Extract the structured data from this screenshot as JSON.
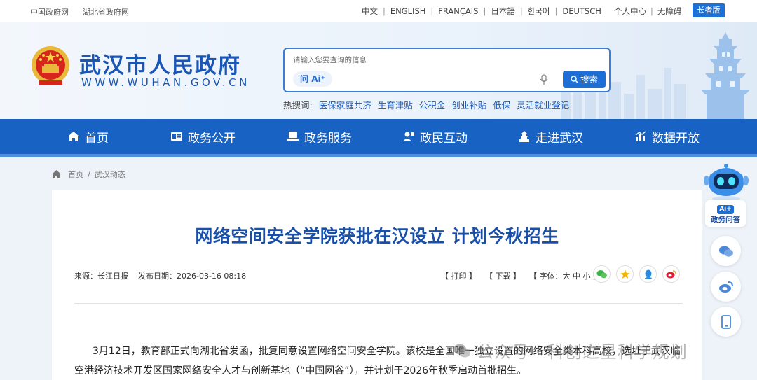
{
  "topbar": {
    "gov_links": [
      "中国政府网",
      "湖北省政府网"
    ],
    "languages": [
      "中文",
      "ENGLISH",
      "FRANÇAIS",
      "日本語",
      "한국어",
      "DEUTSCH"
    ],
    "user_links": [
      "个人中心",
      "无障碍"
    ],
    "elder_mode": "长者版"
  },
  "header": {
    "title": "武汉市人民政府",
    "url": "WWW.WUHAN.GOV.CN",
    "search": {
      "placeholder": "请输入您要查询的信息",
      "ai_label": "问 Ai⁺",
      "button": "搜索"
    },
    "hot_label": "热搜词:",
    "hot_words": [
      "医保家庭共济",
      "生育津贴",
      "公积金",
      "创业补贴",
      "低保",
      "灵活就业登记"
    ]
  },
  "nav": [
    "首页",
    "政务公开",
    "政务服务",
    "政民互动",
    "走进武汉",
    "数据开放"
  ],
  "breadcrumb": {
    "home": "首页",
    "sep": "/",
    "current": "武汉动态"
  },
  "article": {
    "title": "网络空间安全学院获批在汉设立 计划今秋招生",
    "source": "来源：长江日报",
    "date": "发布日期：2026-03-16 08:18",
    "tools": {
      "print": "【 打印 】",
      "download": "【 下载 】",
      "font": "【 字体：大 中 小 】"
    },
    "para1": "3月12日，教育部正式向湖北省发函，批复同意设置网络空间安全学院。该校是全国唯一独立设置的网络安全类本科高校，选址于武汉临",
    "para2": "空港经济技术开发区国家网络安全人才与创新基地（“中国网谷”），并计划于2026年秋季启动首批招生。"
  },
  "side": {
    "ai_badge": "Ai+",
    "ai_label": "政务问答"
  },
  "watermark": "公众号 · 科创之星科学规划",
  "colors": {
    "brand": "#1762c3",
    "title": "#1a4fa8",
    "accent": "#1d6fd6"
  }
}
